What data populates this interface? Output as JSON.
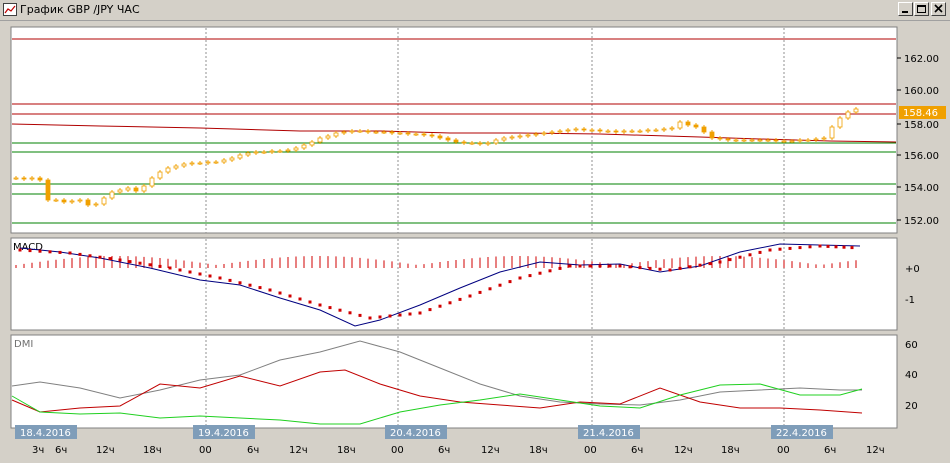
{
  "window": {
    "title": "График GBP /JPY ЧАС",
    "icons": [
      "chart-icon",
      "minimize-icon",
      "maximize-icon",
      "close-icon"
    ]
  },
  "colors": {
    "background": "#ffffff",
    "candle": "#f0a000",
    "price_tag": "#f0a000",
    "red_line": "#b00000",
    "green_line": "#008000",
    "macd_line": "#000080",
    "signal_dots": "#d00000",
    "hist": "#d00000",
    "dmi_gray": "#808080",
    "dmi_red": "#c00000",
    "dmi_green": "#20d020",
    "date_tag": "#7f9db9"
  },
  "price_panel": {
    "current_price": "158.46",
    "y_ticks": [
      "162.00",
      "160.00",
      "158.00",
      "156.00",
      "154.00",
      "152.00"
    ]
  },
  "macd_panel": {
    "label": "MACD",
    "y_ticks": [
      "+0",
      "-1"
    ]
  },
  "dmi_panel": {
    "label": "DMI",
    "y_ticks": [
      "60",
      "40",
      "20"
    ]
  },
  "time_axis": {
    "dates": [
      "18.4.2016",
      "19.4.2016",
      "20.4.2016",
      "21.4.2016",
      "22.4.2016"
    ],
    "hours": [
      "3ч",
      "6ч",
      "12ч",
      "18ч",
      "00",
      "6ч",
      "12ч",
      "18ч",
      "00",
      "6ч",
      "12ч",
      "18ч",
      "00",
      "6ч",
      "12ч",
      "18ч",
      "00",
      "6ч",
      "12ч"
    ]
  }
}
